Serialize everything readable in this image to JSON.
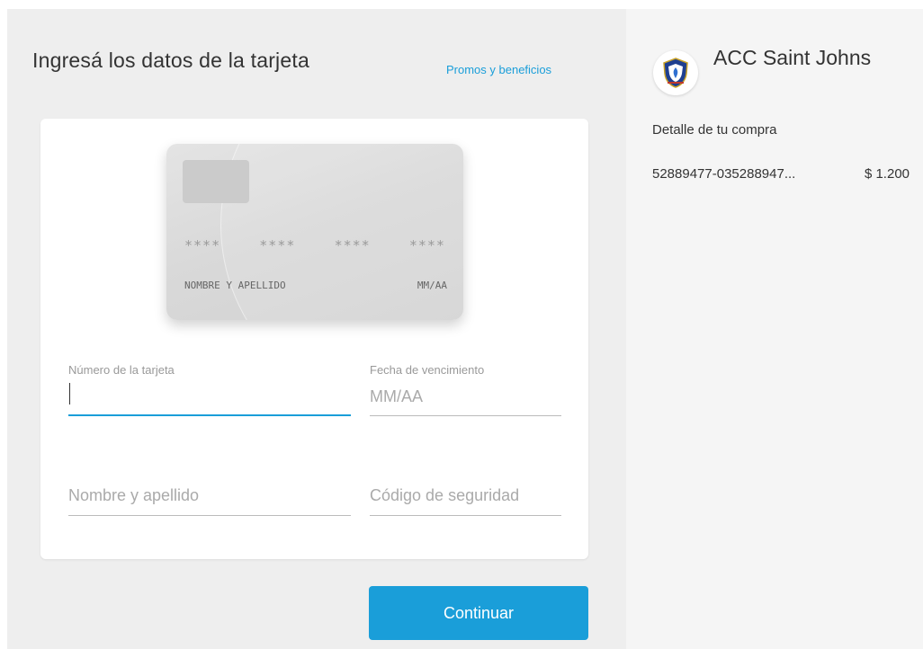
{
  "header": {
    "title": "Ingresá los datos de la tarjeta",
    "promos_link": "Promos y beneficios"
  },
  "card_preview": {
    "number_groups": [
      "****",
      "****",
      "****",
      "****"
    ],
    "holder_placeholder": "NOMBRE Y APELLIDO",
    "expiry_placeholder": "MM/AA"
  },
  "form": {
    "card_number_label": "Número de la tarjeta",
    "card_number_value": "",
    "expiry_label": "Fecha de vencimiento",
    "expiry_placeholder": "MM/AA",
    "name_placeholder": "Nombre y apellido",
    "security_code_placeholder": "Código de seguridad"
  },
  "actions": {
    "continue_label": "Continuar"
  },
  "sidebar": {
    "merchant_name": "ACC Saint Johns",
    "detail_heading": "Detalle de tu compra",
    "order_id": "52889477-035288947...",
    "order_amount": "$ 1.200"
  },
  "colors": {
    "accent": "#1a9ed9",
    "left_background": "#eeeeee",
    "right_background": "#f5f5f5"
  },
  "icons": {
    "logo": "shield-crest-icon"
  }
}
